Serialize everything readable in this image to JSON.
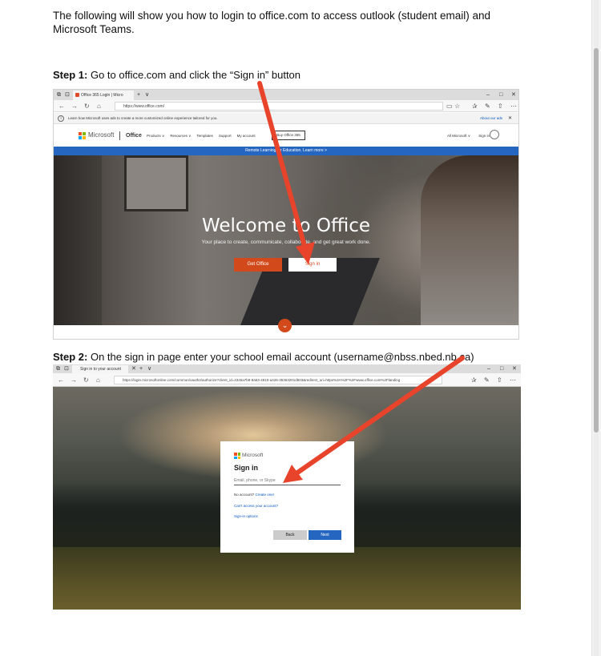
{
  "document": {
    "intro": "The following will show you how to login to office.com to access outlook (student email) and Microsoft Teams.",
    "step1": {
      "label": "Step 1:",
      "text": " Go to office.com and click the “Sign in” button"
    },
    "step2": {
      "label": "Step 2:",
      "text": " On the sign in page enter your school email account (username@nbss.nbed.nb.ca)"
    }
  },
  "screenshot1": {
    "tab_title": "Office 365 Login | Micro",
    "url": "https://www.office.com/",
    "infobar_text": "Learn how Microsoft uses ads to create a more customized online experience tailored for you.",
    "infobar_link": "About our ads",
    "brand": "Microsoft",
    "product": "Office",
    "nav_links": [
      "Products ∨",
      "Resources ∨",
      "Templates",
      "Support",
      "My account"
    ],
    "buy_button": "Buy Office 365",
    "nav_right": "All Microsoft ∨",
    "nav_signin": "Sign in",
    "banner": "Remote Learning for Education. Learn more >",
    "hero_title": "Welcome to Office",
    "hero_subtitle": "Your place to create, communicate, collaborate, and get great work done.",
    "get_office": "Get Office",
    "sign_in": "Sign in"
  },
  "screenshot2": {
    "tab_title": "Sign in to your account",
    "url": "https://login.microsoftonline.com/common/oauth2/authorize?client_id=4345a7b9-9a63-4910-a426-35363201d503&redirect_uri=https%3A%2F%2Fwww.office.com%2Flanding",
    "brand": "Microsoft",
    "title": "Sign in",
    "input_placeholder": "Email, phone, or Skype",
    "no_account": "No account?",
    "create_one": "Create one!",
    "cant_access": "Can't access your account?",
    "sign_in_options": "Sign-in options",
    "back": "Back",
    "next": "Next"
  },
  "colors": {
    "arrow": "#e8432b",
    "office_orange": "#d24a1b",
    "ms_blue": "#2566c0"
  }
}
